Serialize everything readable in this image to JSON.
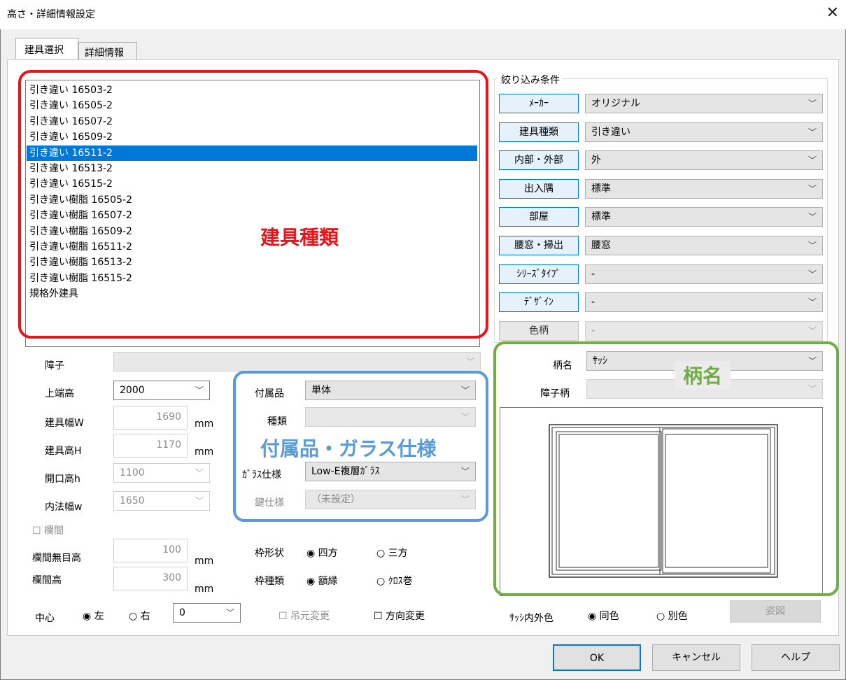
{
  "window": {
    "title": "高さ・詳細情報設定",
    "close_glyph": "✕"
  },
  "tabs": [
    {
      "label": "建具選択"
    },
    {
      "label": "詳細情報"
    }
  ],
  "list": {
    "items": [
      "引き違い 16503-2",
      "引き違い 16505-2",
      "引き違い 16507-2",
      "引き違い 16509-2",
      "引き違い 16511-2",
      "引き違い 16513-2",
      "引き違い 16515-2",
      "引き違い樹脂 16505-2",
      "引き違い樹脂 16507-2",
      "引き違い樹脂 16509-2",
      "引き違い樹脂 16511-2",
      "引き違い樹脂 16513-2",
      "引き違い樹脂 16515-2",
      "規格外建具"
    ],
    "selected_index": 4
  },
  "filter": {
    "legend": "絞り込み条件",
    "rows": [
      {
        "button": "ﾒｰｶｰ",
        "value": "オリジナル"
      },
      {
        "button": "建具種類",
        "value": "引き違い"
      },
      {
        "button": "内部・外部",
        "value": "外"
      },
      {
        "button": "出入隅",
        "value": "標準"
      },
      {
        "button": "部屋",
        "value": "標準"
      },
      {
        "button": "腰窓・掃出",
        "value": "腰窓"
      },
      {
        "button": "ｼﾘｰｽﾞﾀｲﾌﾟ",
        "value": "-"
      },
      {
        "button": "ﾃﾞｻﾞｲﾝ",
        "value": "-"
      },
      {
        "button": "色柄",
        "value": "-"
      }
    ]
  },
  "left_fields": {
    "shoji_label": "障子",
    "top_height_label": "上端高",
    "top_height_value": "2000",
    "width_label": "建具幅W",
    "width_value": "1690",
    "width_unit": "mm",
    "height_label": "建具高H",
    "height_value": "1170",
    "height_unit": "mm",
    "opening_label": "開口高h",
    "opening_value": "1100",
    "inner_width_label": "内法幅w",
    "inner_width_value": "1650",
    "ranma_checkbox_label": "欄間",
    "ranma_mume_label": "欄間無目高",
    "ranma_mume_value": "100",
    "ranma_mume_unit": "mm",
    "ranma_height_label": "欄間高",
    "ranma_height_value": "300",
    "ranma_height_unit": "mm",
    "center_label": "中心",
    "center_left": "左",
    "center_right": "右",
    "center_value": "0"
  },
  "accessory": {
    "accessory_label": "付属品",
    "accessory_value": "単体",
    "kind_label": "種類",
    "glass_label": "ｶﾞﾗｽ仕様",
    "glass_value": "Low-E複層ｶﾞﾗｽ",
    "key_label": "鍵仕様",
    "key_value": "（未設定）"
  },
  "frame": {
    "shape_label": "枠形状",
    "shape_opt1": "四方",
    "shape_opt2": "三方",
    "type_label": "枠種類",
    "type_opt1": "額縁",
    "type_opt2": "ｸﾛｽ巻",
    "hangmoto_label": "吊元変更",
    "direction_label": "方向変更"
  },
  "pattern": {
    "name_label": "柄名",
    "name_value": "ｻｯｼ",
    "shoji_pattern_label": "障子柄",
    "sash_color_label": "ｻｯｼ内外色",
    "sash_same": "同色",
    "sash_other": "別色",
    "elevation_button": "姿図"
  },
  "footer": {
    "ok": "OK",
    "cancel": "キャンセル",
    "help": "ヘルプ"
  },
  "annotations": {
    "red": "建具種類",
    "blue": "付属品・ガラス仕様",
    "green": "柄名",
    "red_color": "#e8141a",
    "blue_color": "#5b9bd5",
    "green_color": "#70ad47"
  }
}
